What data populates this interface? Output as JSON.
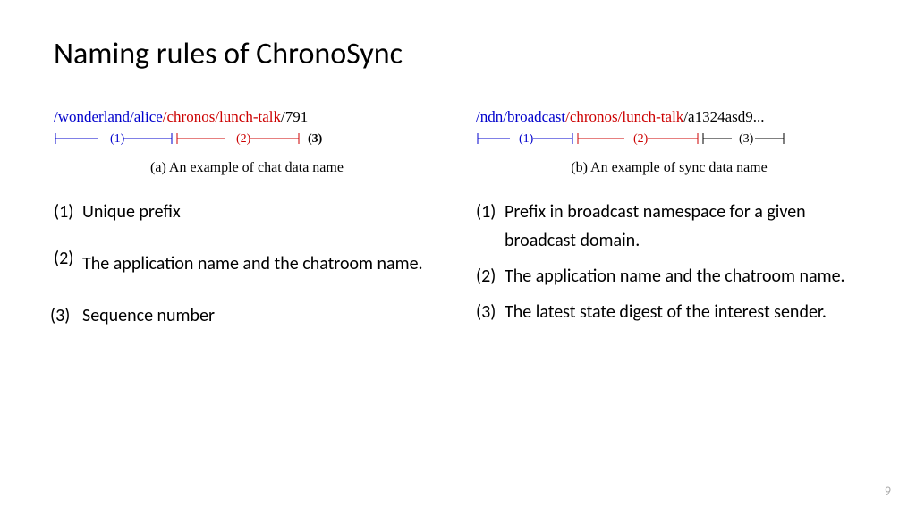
{
  "title": "Naming rules of ChronoSync",
  "left": {
    "name": {
      "seg1": "/wonderland/alice",
      "sep1": "/",
      "seg2": "chronos/lunch-talk",
      "sep2": "/",
      "seg3": "791"
    },
    "labels": {
      "l1": "(1)",
      "l2": "(2)",
      "l3": "(3)"
    },
    "caption": "(a) An example of chat data name",
    "items": [
      {
        "num": "(1)",
        "text": "Unique prefix"
      },
      {
        "num": "(2)",
        "text": "The application name and the chatroom name."
      },
      {
        "num": "(3)",
        "text": "Sequence number",
        "nowrap": true
      }
    ]
  },
  "right": {
    "name": {
      "seg1": "/ndn/broadcast",
      "sep1": "/",
      "seg2": "chronos/lunch-talk",
      "sep2": "/",
      "seg3": "a1324asd9..."
    },
    "labels": {
      "l1": "(1)",
      "l2": "(2)",
      "l3": "(3)"
    },
    "caption": "(b) An example of sync data name",
    "items": [
      {
        "num": "(1)",
        "text": "Prefix in broadcast namespace for a given broadcast domain."
      },
      {
        "num": "(2)",
        "text": "The application name and the chatroom name."
      },
      {
        "num": "(3)",
        "text": "The latest state digest of the interest sender."
      }
    ]
  },
  "page_number": "9"
}
